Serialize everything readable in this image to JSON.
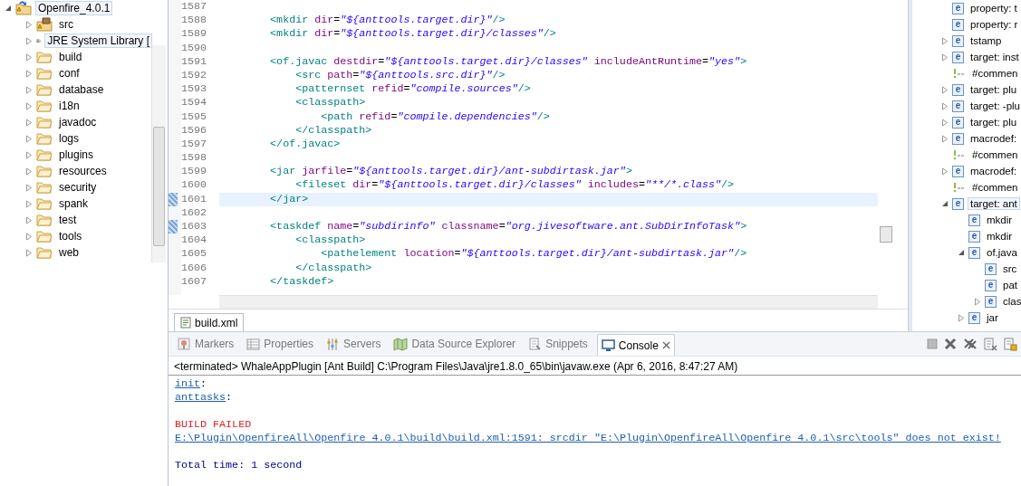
{
  "project_explorer": {
    "items": [
      {
        "kind": "project",
        "label": "Openfire_4.0.1",
        "expanded": true,
        "selected": true,
        "children": [
          {
            "kind": "source",
            "label": "src",
            "expanded": false,
            "selected": false
          },
          {
            "kind": "library",
            "label": "JRE System Library [",
            "expanded": false,
            "selected": true
          },
          {
            "kind": "folder",
            "label": "build",
            "expanded": false,
            "selected": false
          },
          {
            "kind": "folder",
            "label": "conf",
            "expanded": false,
            "selected": false
          },
          {
            "kind": "folder",
            "label": "database",
            "expanded": false,
            "selected": false
          },
          {
            "kind": "folder",
            "label": "i18n",
            "expanded": false,
            "selected": false
          },
          {
            "kind": "folder",
            "label": "javadoc",
            "expanded": false,
            "selected": false
          },
          {
            "kind": "folder",
            "label": "logs",
            "expanded": false,
            "selected": false
          },
          {
            "kind": "folder",
            "label": "plugins",
            "expanded": false,
            "selected": false
          },
          {
            "kind": "folder",
            "label": "resources",
            "expanded": false,
            "selected": false
          },
          {
            "kind": "folder",
            "label": "security",
            "expanded": false,
            "selected": false
          },
          {
            "kind": "folder",
            "label": "spank",
            "expanded": false,
            "selected": false
          },
          {
            "kind": "folder",
            "label": "test",
            "expanded": false,
            "selected": false
          },
          {
            "kind": "folder",
            "label": "tools",
            "expanded": false,
            "selected": false
          },
          {
            "kind": "folder",
            "label": "web",
            "expanded": false,
            "selected": false
          }
        ]
      }
    ]
  },
  "editor": {
    "lines": [
      {
        "number": "1587",
        "current": false,
        "marked": false
      },
      {
        "number": "1588",
        "current": false,
        "marked": false,
        "tokens": [
          {
            "kind": "tag",
            "text": "        <mkdir"
          },
          {
            "kind": "attr",
            "text": " dir"
          },
          {
            "kind": "plain",
            "text": "="
          },
          {
            "kind": "string",
            "text": "\"${anttools.target.dir}\""
          },
          {
            "kind": "tag",
            "text": "/>"
          }
        ]
      },
      {
        "number": "1589",
        "current": false,
        "marked": false,
        "tokens": [
          {
            "kind": "tag",
            "text": "        <mkdir"
          },
          {
            "kind": "attr",
            "text": " dir"
          },
          {
            "kind": "plain",
            "text": "="
          },
          {
            "kind": "string",
            "text": "\"${anttools.target.dir}/classes\""
          },
          {
            "kind": "tag",
            "text": "/>"
          }
        ]
      },
      {
        "number": "1590",
        "current": false,
        "marked": false
      },
      {
        "number": "1591",
        "current": false,
        "marked": false,
        "tokens": [
          {
            "kind": "tag",
            "text": "        <of.javac"
          },
          {
            "kind": "attr",
            "text": " destdir"
          },
          {
            "kind": "plain",
            "text": "="
          },
          {
            "kind": "string",
            "text": "\"${anttools.target.dir}/classes\""
          },
          {
            "kind": "attr",
            "text": " includeAntRuntime"
          },
          {
            "kind": "plain",
            "text": "="
          },
          {
            "kind": "string",
            "text": "\"yes\""
          },
          {
            "kind": "tag",
            "text": ">"
          }
        ]
      },
      {
        "number": "1592",
        "current": false,
        "marked": false,
        "tokens": [
          {
            "kind": "tag",
            "text": "            <src"
          },
          {
            "kind": "attr",
            "text": " path"
          },
          {
            "kind": "plain",
            "text": "="
          },
          {
            "kind": "string",
            "text": "\"${anttools.src.dir}\""
          },
          {
            "kind": "tag",
            "text": "/>"
          }
        ]
      },
      {
        "number": "1593",
        "current": false,
        "marked": false,
        "tokens": [
          {
            "kind": "tag",
            "text": "            <patternset"
          },
          {
            "kind": "attr",
            "text": " refid"
          },
          {
            "kind": "plain",
            "text": "="
          },
          {
            "kind": "string",
            "text": "\"compile.sources\""
          },
          {
            "kind": "tag",
            "text": "/>"
          }
        ]
      },
      {
        "number": "1594",
        "current": false,
        "marked": false,
        "tokens": [
          {
            "kind": "tag",
            "text": "            <classpath>"
          }
        ]
      },
      {
        "number": "1595",
        "current": false,
        "marked": false,
        "tokens": [
          {
            "kind": "tag",
            "text": "                <path"
          },
          {
            "kind": "attr",
            "text": " refid"
          },
          {
            "kind": "plain",
            "text": "="
          },
          {
            "kind": "string",
            "text": "\"compile.dependencies\""
          },
          {
            "kind": "tag",
            "text": "/>"
          }
        ]
      },
      {
        "number": "1596",
        "current": false,
        "marked": false,
        "tokens": [
          {
            "kind": "tag",
            "text": "            </classpath>"
          }
        ]
      },
      {
        "number": "1597",
        "current": false,
        "marked": false,
        "tokens": [
          {
            "kind": "tag",
            "text": "        </of.javac>"
          }
        ]
      },
      {
        "number": "1598",
        "current": false,
        "marked": false
      },
      {
        "number": "1599",
        "current": false,
        "marked": false,
        "tokens": [
          {
            "kind": "tag",
            "text": "        <jar"
          },
          {
            "kind": "attr",
            "text": " jarfile"
          },
          {
            "kind": "plain",
            "text": "="
          },
          {
            "kind": "string",
            "text": "\"${anttools.target.dir}/ant-subdirtask.jar\""
          },
          {
            "kind": "tag",
            "text": ">"
          }
        ]
      },
      {
        "number": "1600",
        "current": false,
        "marked": false,
        "tokens": [
          {
            "kind": "tag",
            "text": "            <fileset"
          },
          {
            "kind": "attr",
            "text": " dir"
          },
          {
            "kind": "plain",
            "text": "="
          },
          {
            "kind": "string",
            "text": "\"${anttools.target.dir}/classes\""
          },
          {
            "kind": "attr",
            "text": " includes"
          },
          {
            "kind": "plain",
            "text": "="
          },
          {
            "kind": "string",
            "text": "\"**/*.class\""
          },
          {
            "kind": "tag",
            "text": "/>"
          }
        ]
      },
      {
        "number": "1601",
        "current": true,
        "marked": true,
        "tokens": [
          {
            "kind": "tag",
            "text": "        </jar>"
          }
        ]
      },
      {
        "number": "1602",
        "current": false,
        "marked": false
      },
      {
        "number": "1603",
        "current": false,
        "marked": true,
        "tokens": [
          {
            "kind": "tag",
            "text": "        <taskdef"
          },
          {
            "kind": "attr",
            "text": " name"
          },
          {
            "kind": "plain",
            "text": "="
          },
          {
            "kind": "string",
            "text": "\"subdirinfo\""
          },
          {
            "kind": "attr",
            "text": " classname"
          },
          {
            "kind": "plain",
            "text": "="
          },
          {
            "kind": "string",
            "text": "\"org.jivesoftware.ant.SubDirInfoTask\""
          },
          {
            "kind": "tag",
            "text": ">"
          }
        ]
      },
      {
        "number": "1604",
        "current": false,
        "marked": false,
        "tokens": [
          {
            "kind": "tag",
            "text": "            <classpath>"
          }
        ]
      },
      {
        "number": "1605",
        "current": false,
        "marked": false,
        "tokens": [
          {
            "kind": "tag",
            "text": "                <pathelement"
          },
          {
            "kind": "attr",
            "text": " location"
          },
          {
            "kind": "plain",
            "text": "="
          },
          {
            "kind": "string",
            "text": "\"${anttools.target.dir}/ant-subdirtask.jar\""
          },
          {
            "kind": "tag",
            "text": "/>"
          }
        ]
      },
      {
        "number": "1606",
        "current": false,
        "marked": false,
        "tokens": [
          {
            "kind": "tag",
            "text": "            </classpath>"
          }
        ]
      },
      {
        "number": "1607",
        "current": false,
        "marked": false,
        "tokens": [
          {
            "kind": "tag",
            "text": "        </taskdef>"
          }
        ]
      }
    ],
    "tab": {
      "label": "build.xml",
      "selected": true
    }
  },
  "outline": {
    "items": [
      {
        "kind": "element",
        "badge": "e",
        "label": "property: t",
        "selected": false
      },
      {
        "kind": "element",
        "badge": "e",
        "label": "property: r",
        "selected": false
      },
      {
        "kind": "element",
        "badge": "e",
        "label": "tstamp",
        "expanded": false,
        "selected": false
      },
      {
        "kind": "element",
        "badge": "e",
        "label": "target: inst",
        "expanded": false,
        "selected": false
      },
      {
        "kind": "comment",
        "label": "#commen",
        "selected": false
      },
      {
        "kind": "element",
        "badge": "e",
        "label": "target: plu",
        "expanded": false,
        "selected": false
      },
      {
        "kind": "element",
        "badge": "e",
        "label": "target: -plu",
        "expanded": false,
        "selected": false
      },
      {
        "kind": "element",
        "badge": "e",
        "label": "target: plu",
        "expanded": false,
        "selected": false
      },
      {
        "kind": "element",
        "badge": "e",
        "label": "macrodef:",
        "expanded": false,
        "selected": false
      },
      {
        "kind": "comment",
        "label": "#commen",
        "selected": false
      },
      {
        "kind": "element",
        "badge": "e",
        "label": "macrodef:",
        "expanded": false,
        "selected": false
      },
      {
        "kind": "comment",
        "label": "#commen",
        "selected": false
      },
      {
        "kind": "element",
        "badge": "e",
        "label": "target: ant",
        "expanded": true,
        "selected": true,
        "children": [
          {
            "kind": "element",
            "badge": "e",
            "label": "mkdir",
            "selected": false
          },
          {
            "kind": "element",
            "badge": "e",
            "label": "mkdir",
            "selected": false
          },
          {
            "kind": "element",
            "badge": "e",
            "label": "of.java",
            "expanded": true,
            "selected": false,
            "children": [
              {
                "kind": "element",
                "badge": "e",
                "label": "src",
                "selected": false
              },
              {
                "kind": "element",
                "badge": "e",
                "label": "pat",
                "selected": false
              },
              {
                "kind": "element",
                "badge": "e",
                "label": "clas",
                "expanded": false,
                "selected": false
              }
            ]
          },
          {
            "kind": "element",
            "badge": "e",
            "label": "jar",
            "expanded": false,
            "selected": false
          }
        ]
      }
    ]
  },
  "console": {
    "tabs": [
      {
        "kind": "markers",
        "label": "Markers",
        "selected": false
      },
      {
        "kind": "properties",
        "label": "Properties",
        "selected": false
      },
      {
        "kind": "servers",
        "label": "Servers",
        "selected": false
      },
      {
        "kind": "datasource",
        "label": "Data Source Explorer",
        "selected": false
      },
      {
        "kind": "snippets",
        "label": "Snippets",
        "selected": false
      },
      {
        "kind": "console",
        "label": "Console",
        "selected": true
      }
    ],
    "header": "<terminated> WhaleAppPlugin [Ant Build] C:\\Program Files\\Java\\jre1.8.0_65\\bin\\javaw.exe (Apr 6, 2016, 8:47:27 AM)",
    "groups": [
      {
        "lines": [
          {
            "tokens": [
              {
                "kind": "link",
                "text": "init"
              },
              {
                "kind": "output",
                "text": ":"
              }
            ]
          },
          {
            "tokens": [
              {
                "kind": "link",
                "text": "anttasks"
              },
              {
                "kind": "output",
                "text": ":"
              }
            ]
          }
        ]
      },
      {
        "lines": [
          {
            "tokens": [
              {
                "kind": "error",
                "text": "BUILD FAILED"
              }
            ]
          },
          {
            "tokens": [
              {
                "kind": "link",
                "text": "E:\\Plugin\\OpenfireAll\\Openfire 4.0.1\\build\\build.xml:1591: srcdir \"E:\\Plugin\\OpenfireAll\\Openfire 4.0.1\\src\\tools\" does not exist!"
              }
            ]
          }
        ]
      },
      {
        "lines": [
          {
            "tokens": [
              {
                "kind": "output",
                "text": "Total time: 1 second"
              }
            ]
          }
        ]
      }
    ]
  }
}
